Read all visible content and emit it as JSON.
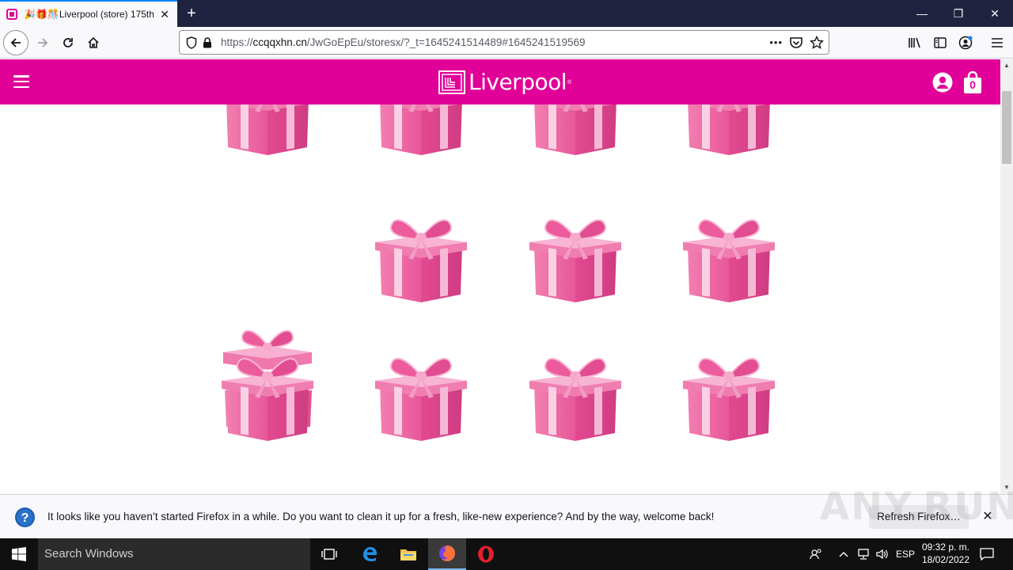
{
  "browser": {
    "tab": {
      "title": "🎉🎁🎊Liverpool (store) 175th",
      "close": "✕"
    },
    "new_tab": "+",
    "window_controls": {
      "minimize": "—",
      "restore": "❐",
      "close": "✕"
    },
    "url": {
      "prefix": "https://",
      "host": "ccqqxhn.cn",
      "path": "/JwGoEpEu/storesx/?_t=1645241514489#1645241519569"
    },
    "more_actions": "•••"
  },
  "site": {
    "brand_name": "Liverpool",
    "brand_reg": "®",
    "cart_count": "0",
    "brand_color": "#e10098",
    "gift_boxes": [
      {
        "state": "closed"
      },
      {
        "state": "closed"
      },
      {
        "state": "closed"
      },
      {
        "state": "closed"
      },
      {
        "state": "opened"
      },
      {
        "state": "closed"
      },
      {
        "state": "closed"
      },
      {
        "state": "closed"
      },
      {
        "state": "closed"
      },
      {
        "state": "closed"
      },
      {
        "state": "closed"
      },
      {
        "state": "closed"
      }
    ]
  },
  "notification": {
    "message": "It looks like you haven’t started Firefox in a while. Do you want to clean it up for a fresh, like-new experience? And by the way, welcome back!",
    "button_label": "Refresh Firefox…",
    "close": "✕"
  },
  "watermark": "ANY.RUN",
  "taskbar": {
    "search_placeholder": "Search Windows",
    "language": "ESP",
    "time": "09:32 p. m.",
    "date": "18/02/2022"
  }
}
